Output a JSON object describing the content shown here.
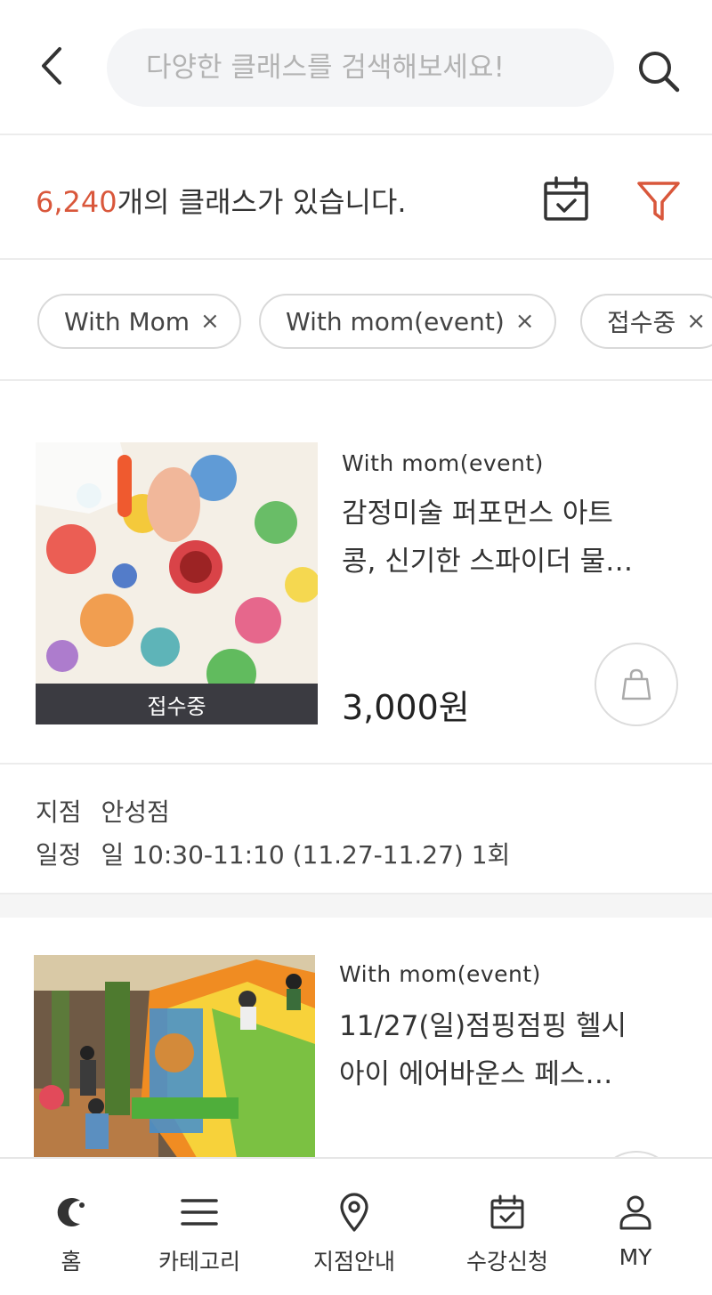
{
  "search": {
    "placeholder": "다양한 클래스를 검색해보세요!"
  },
  "results": {
    "count": "6,240",
    "suffix": "개의 클래스가 있습니다."
  },
  "filters": [
    {
      "label": "With Mom",
      "remove": "×"
    },
    {
      "label": "With mom(event)",
      "remove": "×"
    },
    {
      "label": "접수중",
      "remove": "×"
    }
  ],
  "classes": [
    {
      "category": "With mom(event)",
      "title_line1": "감정미술 퍼포먼스 아트",
      "title_line2": "콩, 신기한 스파이더 물…",
      "price": "3,000원",
      "status": "접수중",
      "branch_key": "지점",
      "branch_value": "안성점",
      "schedule_key": "일정",
      "schedule_value": "일 10:30-11:10 (11.27-11.27) 1회"
    },
    {
      "category": "With mom(event)",
      "title_line1": "11/27(일)점핑점핑 헬시",
      "title_line2": "아이 에어바운스 페스…"
    }
  ],
  "nav": [
    {
      "label": "홈",
      "icon": "home-logo-icon"
    },
    {
      "label": "카테고리",
      "icon": "menu-icon"
    },
    {
      "label": "지점안내",
      "icon": "location-pin-icon"
    },
    {
      "label": "수강신청",
      "icon": "calendar-check-icon"
    },
    {
      "label": "MY",
      "icon": "user-icon"
    }
  ],
  "colors": {
    "accent": "#d9573b",
    "status_bar": "#3b3b41"
  }
}
